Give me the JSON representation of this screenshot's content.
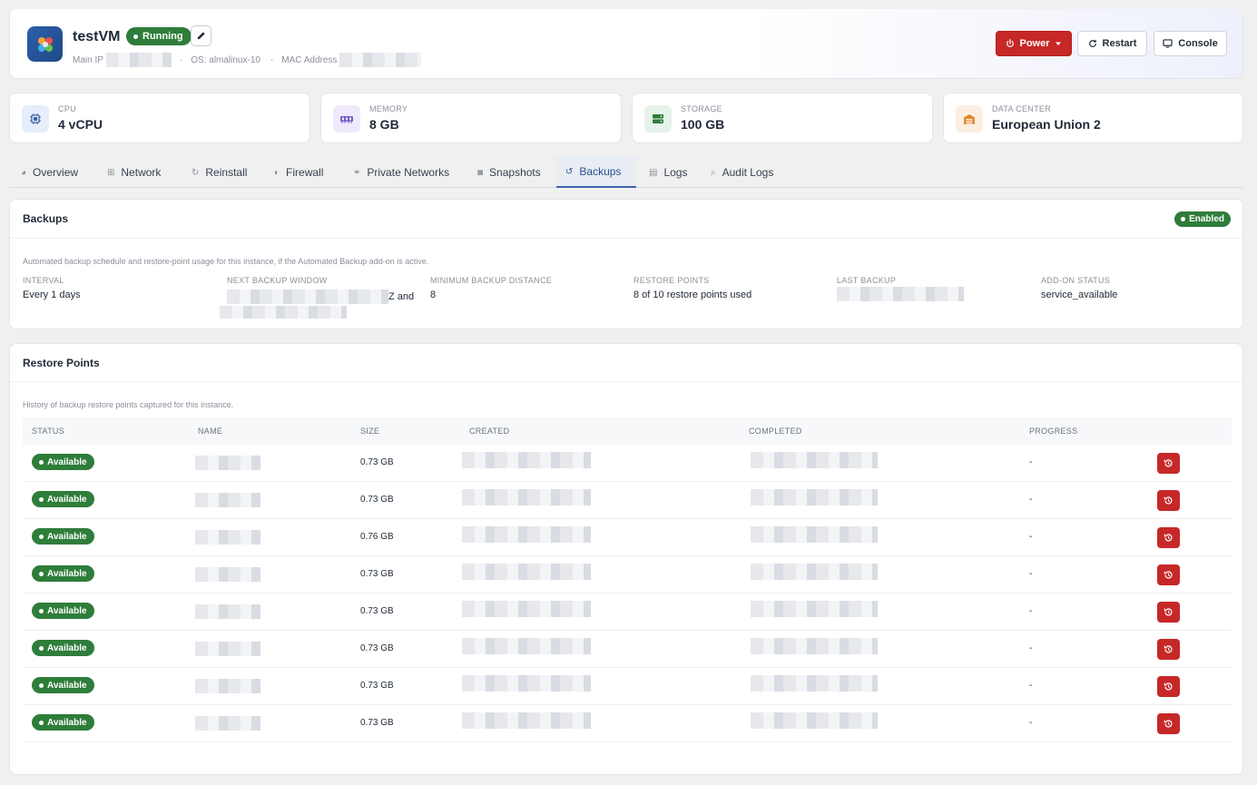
{
  "header": {
    "vm_name": "testVM",
    "status": "Running",
    "main_ip_label": "Main IP",
    "os_label": "OS: almalinux-10",
    "mac_label": "MAC Address",
    "power_label": "Power",
    "restart_label": "Restart",
    "console_label": "Console"
  },
  "stats": [
    {
      "label": "CPU",
      "value": "4 vCPU"
    },
    {
      "label": "MEMORY",
      "value": "8 GB"
    },
    {
      "label": "STORAGE",
      "value": "100 GB"
    },
    {
      "label": "DATA CENTER",
      "value": "European Union 2"
    }
  ],
  "tabs": [
    {
      "label": "Overview",
      "icon": "gauge-icon"
    },
    {
      "label": "Network",
      "icon": "network-icon"
    },
    {
      "label": "Reinstall",
      "icon": "refresh-icon"
    },
    {
      "label": "Firewall",
      "icon": "shield-icon"
    },
    {
      "label": "Private Networks",
      "icon": "share-icon"
    },
    {
      "label": "Snapshots",
      "icon": "camera-icon"
    },
    {
      "label": "Backups",
      "icon": "history-icon"
    },
    {
      "label": "Logs",
      "icon": "document-icon"
    },
    {
      "label": "Audit Logs",
      "icon": "search-icon"
    }
  ],
  "active_tab": "Backups",
  "backups": {
    "title": "Backups",
    "status": "Enabled",
    "description": "Automated backup schedule and restore-point usage for this instance, if the Automated Backup add-on is active.",
    "interval_label": "INTERVAL",
    "interval_value": "Every 1 days",
    "next_window_label": "NEXT BACKUP WINDOW",
    "next_window_tail": "Z and",
    "min_distance_label": "MINIMUM BACKUP DISTANCE",
    "min_distance_value": "8",
    "restore_points_label": "RESTORE POINTS",
    "restore_points_value": "8 of 10 restore points used",
    "last_backup_label": "LAST BACKUP",
    "addon_status_label": "ADD-ON STATUS",
    "addon_status_value": "service_available"
  },
  "restore_points": {
    "title": "Restore Points",
    "description": "History of backup restore points captured for this instance.",
    "columns": {
      "status": "STATUS",
      "name": "NAME",
      "size": "SIZE",
      "created": "CREATED",
      "completed": "COMPLETED",
      "progress": "PROGRESS"
    },
    "rows": [
      {
        "status": "Available",
        "size": "0.73 GB",
        "progress": "-"
      },
      {
        "status": "Available",
        "size": "0.73 GB",
        "progress": "-"
      },
      {
        "status": "Available",
        "size": "0.76 GB",
        "progress": "-"
      },
      {
        "status": "Available",
        "size": "0.73 GB",
        "progress": "-"
      },
      {
        "status": "Available",
        "size": "0.73 GB",
        "progress": "-"
      },
      {
        "status": "Available",
        "size": "0.73 GB",
        "progress": "-"
      },
      {
        "status": "Available",
        "size": "0.73 GB",
        "progress": "-"
      },
      {
        "status": "Available",
        "size": "0.73 GB",
        "progress": "-"
      }
    ]
  },
  "colors": {
    "accent": "#3b64a8",
    "success": "#2e7d3a",
    "danger": "#c62828"
  }
}
